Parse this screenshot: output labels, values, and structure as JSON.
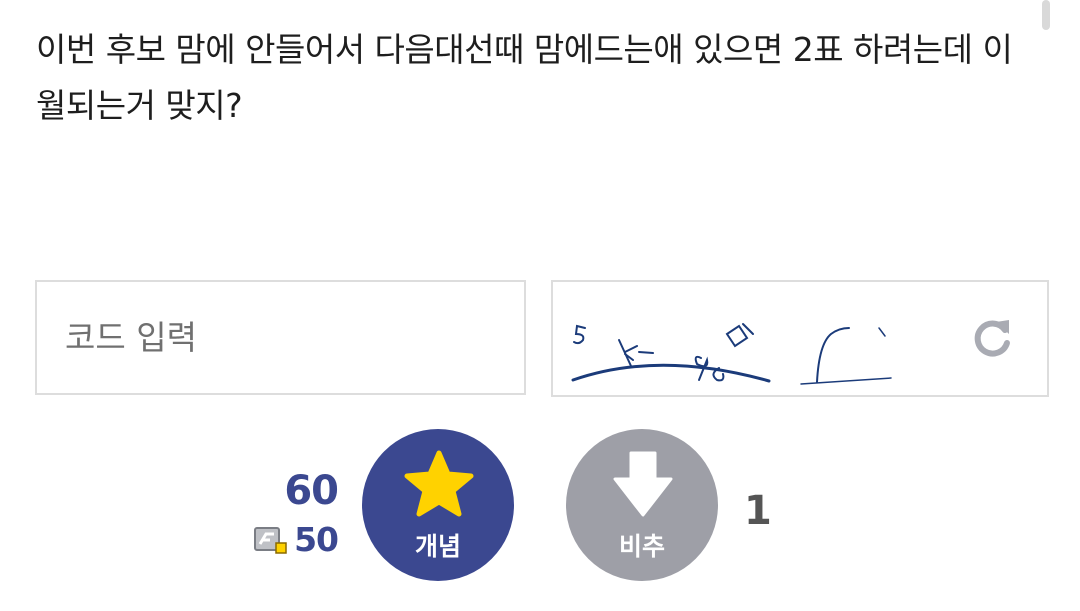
{
  "post": {
    "body_text": "이번 후보 맘에 안들어서 다음대선때 맘에드는애 있으면 2표 하려는데 이월되는거 맞지?"
  },
  "captcha": {
    "input_placeholder": "코드 입력",
    "input_value": "",
    "refresh_icon": "refresh-icon"
  },
  "votes": {
    "up_count": "60",
    "fix_count": "50",
    "up_label": "개념",
    "down_label": "비추",
    "down_count": "1",
    "up_icon": "star-icon",
    "down_icon": "arrow-down-icon",
    "fix_icon": "fixed-user-icon"
  },
  "colors": {
    "accent": "#3b4890",
    "down_gray": "#9e9fa7",
    "star": "#ffd200",
    "captcha_ink": "#1b3b7a",
    "refresh_gray": "#a9abb3"
  }
}
